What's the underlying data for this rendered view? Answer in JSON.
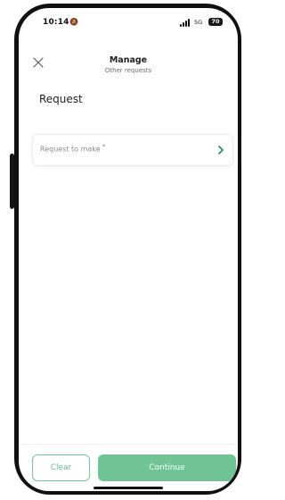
{
  "status_bar": {
    "time": "10:14",
    "network": "5G",
    "battery": "70"
  },
  "header": {
    "title": "Manage",
    "subtitle": "Other requests"
  },
  "section": {
    "title": "Request"
  },
  "request_field": {
    "label": "Request to make",
    "required_mark": "*"
  },
  "actions": {
    "clear_label": "Clear",
    "continue_label": "Continue"
  },
  "colors": {
    "accent": "#6fc395",
    "accent_dark": "#2e8f5b"
  }
}
